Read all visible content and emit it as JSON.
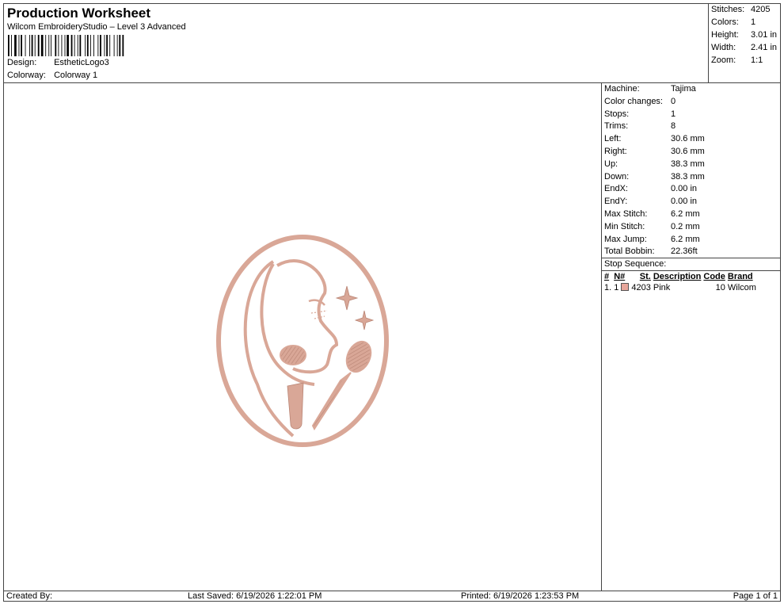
{
  "header": {
    "title": "Production Worksheet",
    "subtitle": "Wilcom EmbroideryStudio – Level 3 Advanced",
    "design_label": "Design:",
    "design_value": "EstheticLogo3",
    "colorway_label": "Colorway:",
    "colorway_value": "Colorway 1"
  },
  "summary": {
    "stitches_label": "Stitches:",
    "stitches_value": "4205",
    "colors_label": "Colors:",
    "colors_value": "1",
    "height_label": "Height:",
    "height_value": "3.01 in",
    "width_label": "Width:",
    "width_value": "2.41 in",
    "zoom_label": "Zoom:",
    "zoom_value": "1:1"
  },
  "info": {
    "rows": [
      {
        "label": "Machine:",
        "value": "Tajima"
      },
      {
        "label": "Color changes:",
        "value": "0"
      },
      {
        "label": "Stops:",
        "value": "1"
      },
      {
        "label": "Trims:",
        "value": "8"
      },
      {
        "label": "Left:",
        "value": "30.6 mm"
      },
      {
        "label": "Right:",
        "value": "30.6 mm"
      },
      {
        "label": "Up:",
        "value": "38.3 mm"
      },
      {
        "label": "Down:",
        "value": "38.3 mm"
      },
      {
        "label": "EndX:",
        "value": "0.00 in"
      },
      {
        "label": "EndY:",
        "value": "0.00 in"
      },
      {
        "label": "Max Stitch:",
        "value": "6.2 mm"
      },
      {
        "label": "Min Stitch:",
        "value": "0.2 mm"
      },
      {
        "label": "Max Jump:",
        "value": "6.2 mm"
      },
      {
        "label": "Total Bobbin:",
        "value": "22.36ft"
      }
    ],
    "stop_sequence_title": "Stop Sequence:",
    "table": {
      "headers": [
        "#",
        "N#",
        "St.",
        "Description",
        "Code",
        "Brand"
      ],
      "rows": [
        {
          "index": "1.",
          "n": "1",
          "color": "#E8A79C",
          "st": "4203",
          "description": "Pink",
          "code": "10",
          "brand": "Wilcom"
        }
      ]
    }
  },
  "design": {
    "thread_color": "#D9A797",
    "thread_shadow": "#B98474"
  },
  "footer": {
    "created_by": "Created By:",
    "last_saved": "Last Saved: 6/19/2026 1:22:01 PM",
    "printed": "Printed: 6/19/2026 1:23:53 PM",
    "page": "Page 1 of 1"
  }
}
